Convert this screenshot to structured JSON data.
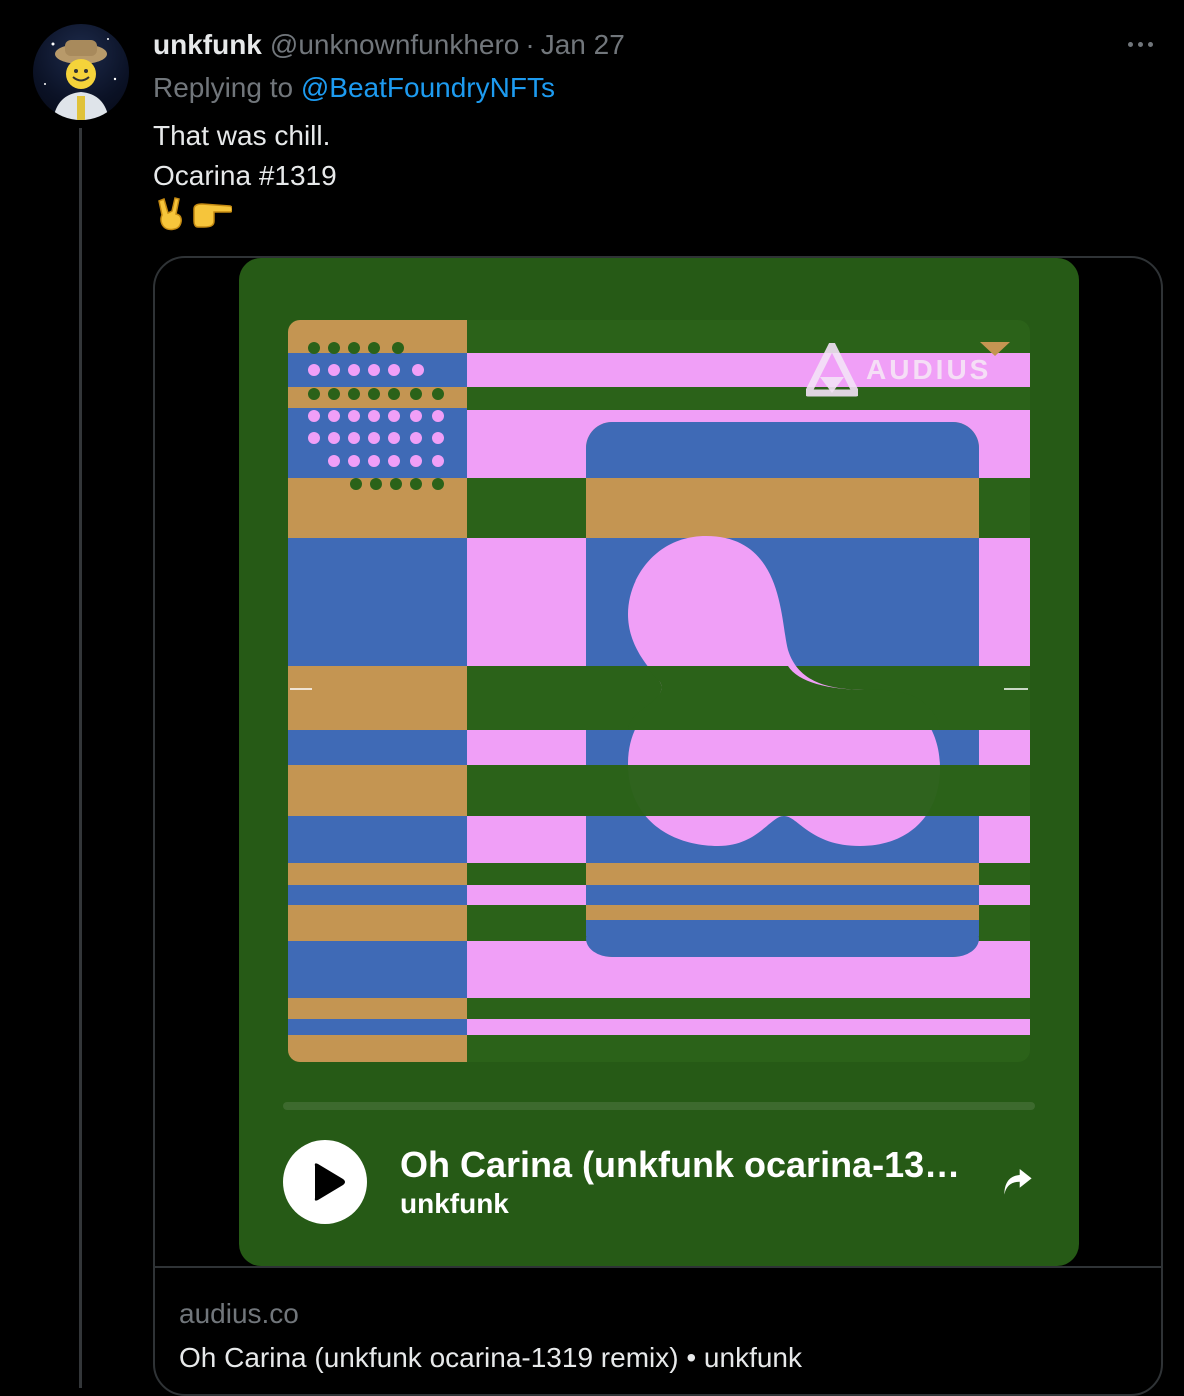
{
  "tweet": {
    "display_name": "unkfunk",
    "handle": "@unknownfunkhero",
    "separator": "·",
    "date": "Jan 27",
    "replying_prefix": "Replying to ",
    "replying_to": "@BeatFoundryNFTs",
    "text_line1": "That was chill.",
    "text_line2": "Ocarina #1319",
    "emojis": [
      "victory-hand",
      "pointing-right"
    ]
  },
  "player": {
    "logo_text": "AUDIUS",
    "track_title": "Oh Carina (unkfunk ocarina-1319 remix)",
    "artist": "unkfunk",
    "progress": 0,
    "colors": {
      "background": "#265a16",
      "pink": "#f09ff7",
      "blue": "#3f6ab6",
      "tan": "#c49552",
      "green": "#265a16"
    }
  },
  "card": {
    "domain": "audius.co",
    "title": "Oh Carina (unkfunk ocarina-1319 remix) • unkfunk"
  },
  "icons": [
    "more-icon",
    "play-icon",
    "share-icon",
    "audius-logo-icon"
  ]
}
